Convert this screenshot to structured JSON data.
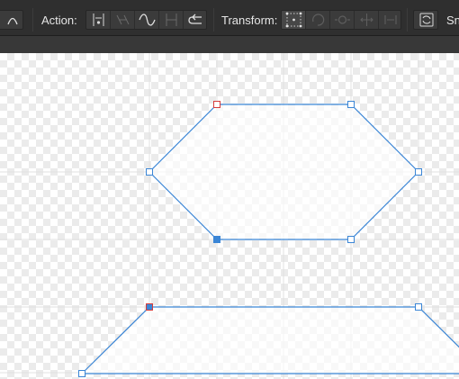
{
  "toolbar": {
    "action_label": "Action:",
    "transform_label": "Transform:",
    "snapping_label": "Sn",
    "icons": {
      "curve_mode": "curve-icon",
      "action": [
        "break-curve-icon",
        "join-curves-icon",
        "smooth-icon",
        "close-curve-icon",
        "reverse-curve-icon"
      ],
      "transform": [
        "transform-origin-icon",
        "rotate-icon",
        "flip-icon",
        "align-icon",
        "distribute-icon"
      ],
      "snapping": "snapping-icon"
    }
  },
  "colors": {
    "path_stroke": "#3b86d6",
    "node_selected_fill": "#3b86d6",
    "node_start_border": "#d63b3b",
    "node_fill": "#ffffff",
    "grid_line": "#e2e2e2"
  }
}
